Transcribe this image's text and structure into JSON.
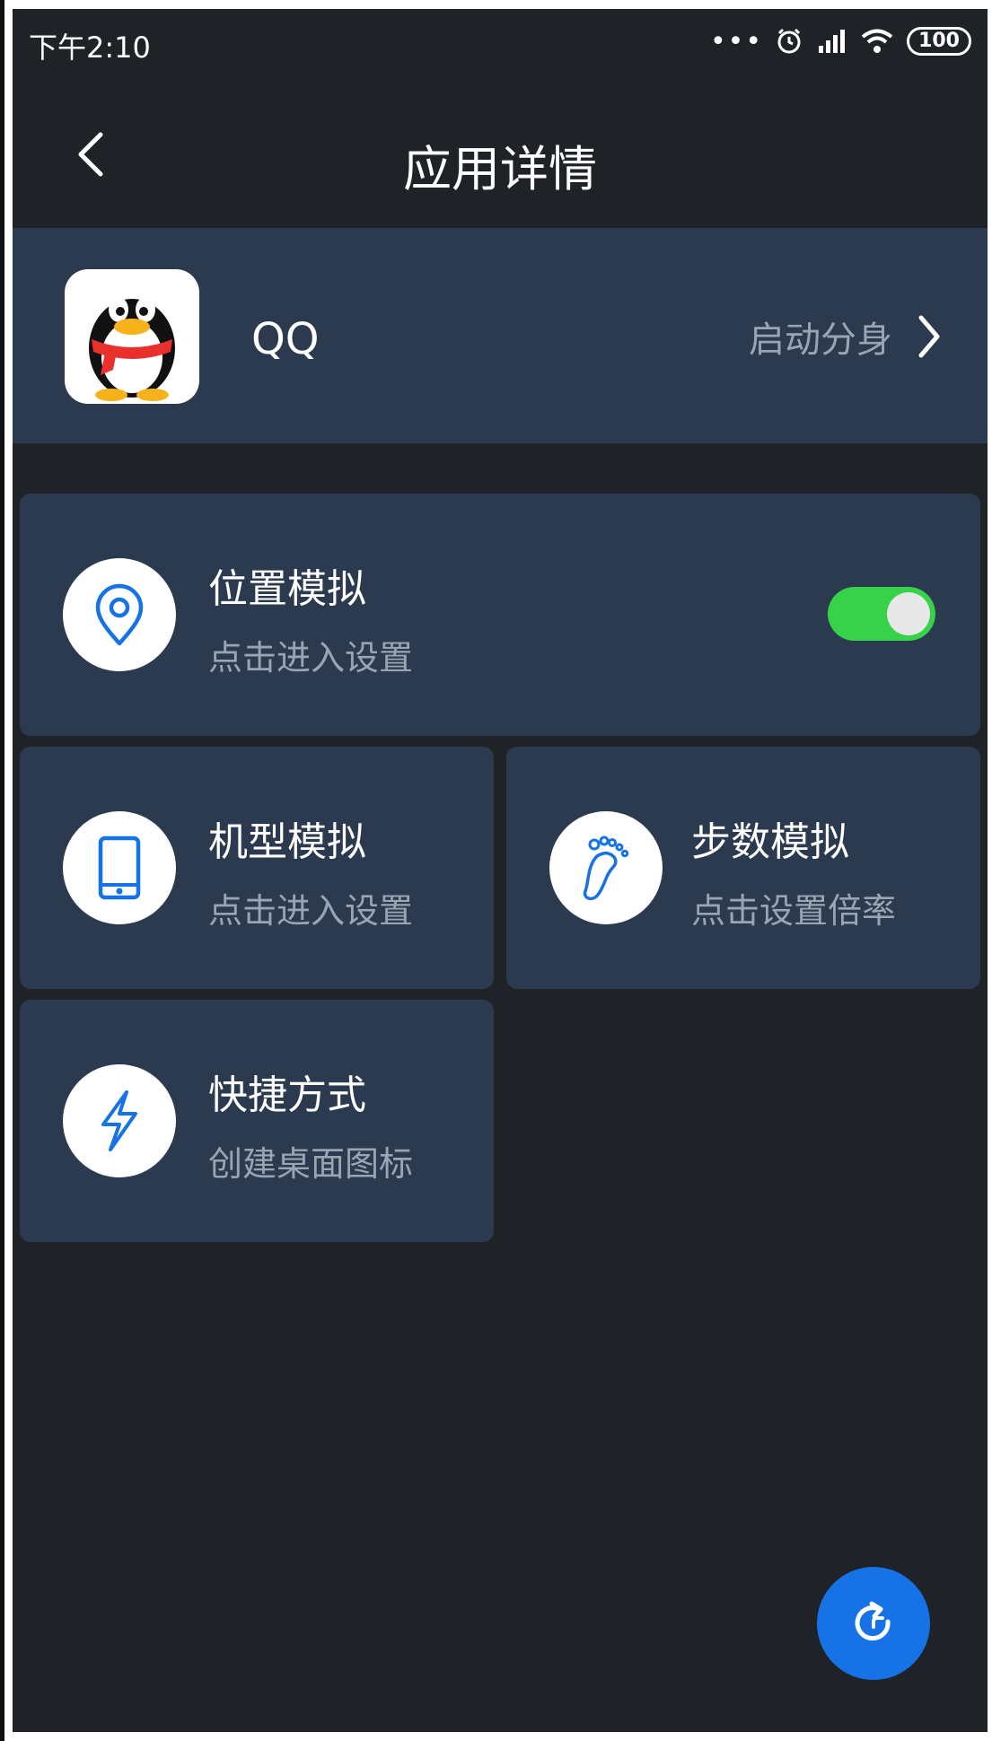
{
  "status_bar": {
    "time": "下午2:10",
    "dots": "•••",
    "battery": "100"
  },
  "header": {
    "title": "应用详情"
  },
  "app": {
    "name": "QQ",
    "launch_clone_label": "启动分身"
  },
  "features": {
    "location": {
      "title": "位置模拟",
      "subtitle": "点击进入设置",
      "enabled": true
    },
    "device": {
      "title": "机型模拟",
      "subtitle": "点击进入设置"
    },
    "steps": {
      "title": "步数模拟",
      "subtitle": "点击设置倍率"
    },
    "shortcut": {
      "title": "快捷方式",
      "subtitle": "创建桌面图标"
    }
  },
  "icons": {
    "back": "chevron-left-icon",
    "launch": "chevron-right-icon",
    "location": "location-pin-icon",
    "device": "phone-icon",
    "steps": "footprint-icon",
    "shortcut": "lightning-icon",
    "fab": "refresh-icon"
  },
  "colors": {
    "background": "#1f2227",
    "card": "#2b3a4f",
    "accent": "#1573e6",
    "toggle_on": "#37d24a",
    "subtitle": "#9aa4b2"
  }
}
